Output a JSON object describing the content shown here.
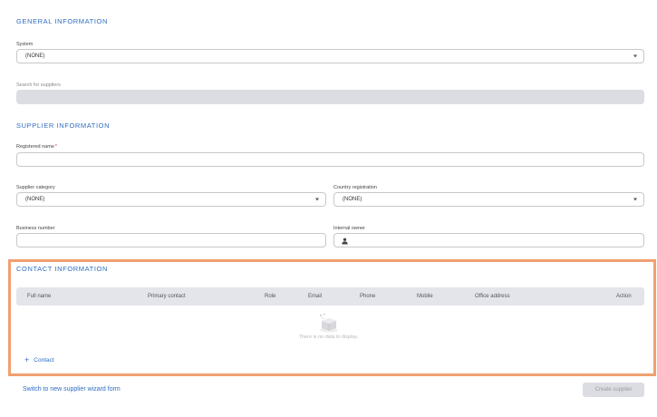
{
  "general": {
    "title": "GENERAL INFORMATION",
    "system_label": "System",
    "system_value": "(NONE)",
    "search_label": "Search for suppliers",
    "search_value": ""
  },
  "supplier": {
    "title": "SUPPLIER INFORMATION",
    "registered_name_label": "Registered name",
    "required_mark": "*",
    "registered_name_value": "",
    "category_label": "Supplier category",
    "category_value": "(NONE)",
    "country_label": "Country registration",
    "country_value": "(NONE)",
    "business_number_label": "Business number",
    "business_number_value": "",
    "internal_owner_label": "Internal owner",
    "internal_owner_value": ""
  },
  "contact": {
    "title": "CONTACT INFORMATION",
    "columns": [
      "Full name",
      "Primary contact",
      "Role",
      "Email",
      "Phone",
      "Mobile",
      "Office address",
      "Action"
    ],
    "empty_text": "There is no data to display.",
    "add_label": "Contact",
    "add_icon": "plus-icon"
  },
  "footer": {
    "switch_label": "Switch to new supplier wizard form",
    "create_label": "Create supplier"
  },
  "colors": {
    "accent": "#2e6cc2",
    "highlight_border": "#f0a070",
    "disabled_fill": "#dcdde3"
  }
}
